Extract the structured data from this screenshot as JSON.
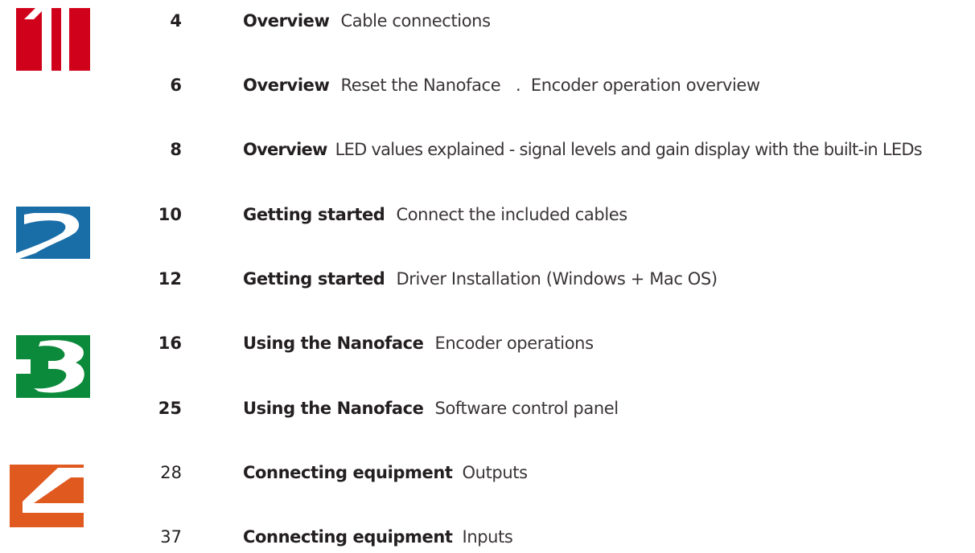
{
  "toc": {
    "entries": [
      {
        "page": "4",
        "section": "Overview",
        "description": "Cable connections"
      },
      {
        "page": "6",
        "section": "Overview",
        "description": "Reset the Nanoface   .  Encoder operation overview"
      },
      {
        "page": "8",
        "section": "Overview",
        "description": "LED values explained - signal levels and gain display with the built-in LEDs"
      },
      {
        "page": "10",
        "section": "Getting started",
        "description": "Connect the included cables"
      },
      {
        "page": "12",
        "section": "Getting started",
        "description": "Driver Installation (Windows + Mac OS)"
      },
      {
        "page": "16",
        "section": "Using the Nanoface",
        "description": "Encoder operations"
      },
      {
        "page": "25",
        "section": "Using the Nanoface",
        "description": "Software control panel"
      },
      {
        "page": "28",
        "section": "Connecting equipment",
        "description": "Outputs"
      },
      {
        "page": "37",
        "section": "Connecting equipment",
        "description": "Inputs"
      }
    ]
  },
  "chapters": [
    {
      "number": "1",
      "color": "#d0021b",
      "icon": "chapter-1-icon"
    },
    {
      "number": "2",
      "color": "#1a6ea8",
      "icon": "chapter-2-icon"
    },
    {
      "number": "3",
      "color": "#0a8a3a",
      "icon": "chapter-3-icon"
    },
    {
      "number": "4",
      "color": "#e0591f",
      "icon": "chapter-4-icon"
    }
  ]
}
